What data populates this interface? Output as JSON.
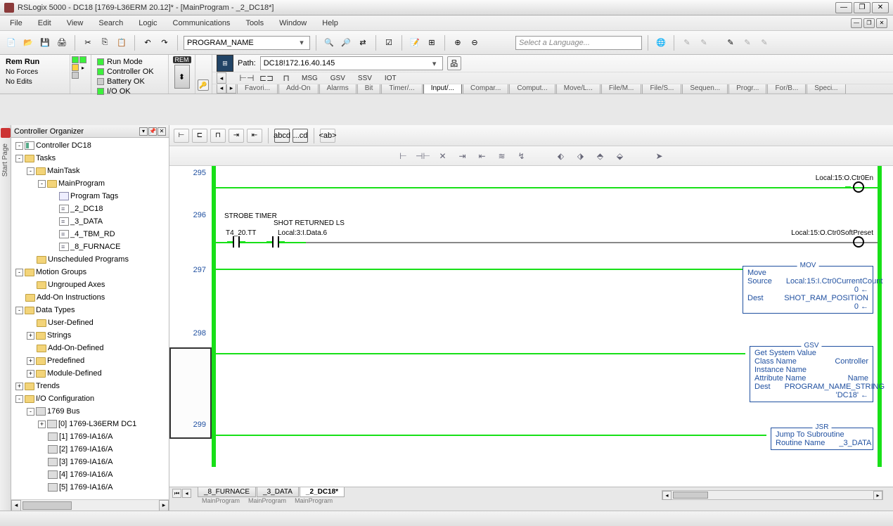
{
  "title": "RSLogix 5000 - DC18 [1769-L36ERM 20.12]* - [MainProgram - _2_DC18*]",
  "menu": [
    "File",
    "Edit",
    "View",
    "Search",
    "Logic",
    "Communications",
    "Tools",
    "Window",
    "Help"
  ],
  "toolbar_program": "PROGRAM_NAME",
  "language_placeholder": "Select a Language...",
  "status": {
    "mode_label": "Rem Run",
    "forces": "No Forces",
    "edits": "No Edits",
    "run_mode": "Run Mode",
    "controller_ok": "Controller OK",
    "battery_ok": "Battery OK",
    "io_ok": "I/O OK",
    "rem": "REM"
  },
  "path": {
    "label": "Path:",
    "value": "DC18!172.16.40.145"
  },
  "inst_text": [
    "MSG",
    "GSV",
    "SSV",
    "IOT"
  ],
  "sub_tabs": [
    "Favori...",
    "Add-On",
    "Alarms",
    "Bit",
    "Timer/...",
    "Input/...",
    "Compar...",
    "Comput...",
    "Move/L...",
    "File/M...",
    "File/S...",
    "Sequen...",
    "Progr...",
    "For/B...",
    "Speci..."
  ],
  "active_sub_tab": 5,
  "org_title": "Controller Organizer",
  "tree": [
    {
      "d": 0,
      "exp": "-",
      "ico": "ctrl",
      "label": "Controller DC18"
    },
    {
      "d": 0,
      "exp": "-",
      "ico": "folder",
      "label": "Tasks"
    },
    {
      "d": 1,
      "exp": "-",
      "ico": "folder",
      "label": "MainTask"
    },
    {
      "d": 2,
      "exp": "-",
      "ico": "folder",
      "label": "MainProgram"
    },
    {
      "d": 3,
      "exp": "",
      "ico": "tag",
      "label": "Program Tags"
    },
    {
      "d": 3,
      "exp": "",
      "ico": "ladder",
      "label": "_2_DC18"
    },
    {
      "d": 3,
      "exp": "",
      "ico": "ladder",
      "label": "_3_DATA"
    },
    {
      "d": 3,
      "exp": "",
      "ico": "ladder",
      "label": "_4_TBM_RD"
    },
    {
      "d": 3,
      "exp": "",
      "ico": "ladder",
      "label": "_8_FURNACE"
    },
    {
      "d": 1,
      "exp": "",
      "ico": "folder",
      "label": "Unscheduled Programs"
    },
    {
      "d": 0,
      "exp": "-",
      "ico": "folder",
      "label": "Motion Groups"
    },
    {
      "d": 1,
      "exp": "",
      "ico": "folder",
      "label": "Ungrouped Axes"
    },
    {
      "d": 0,
      "exp": "",
      "ico": "folder",
      "label": "Add-On Instructions"
    },
    {
      "d": 0,
      "exp": "-",
      "ico": "folder",
      "label": "Data Types"
    },
    {
      "d": 1,
      "exp": "",
      "ico": "folder",
      "label": "User-Defined"
    },
    {
      "d": 1,
      "exp": "+",
      "ico": "folder",
      "label": "Strings"
    },
    {
      "d": 1,
      "exp": "",
      "ico": "folder",
      "label": "Add-On-Defined"
    },
    {
      "d": 1,
      "exp": "+",
      "ico": "folder",
      "label": "Predefined"
    },
    {
      "d": 1,
      "exp": "+",
      "ico": "folder",
      "label": "Module-Defined"
    },
    {
      "d": 0,
      "exp": "+",
      "ico": "folder",
      "label": "Trends"
    },
    {
      "d": 0,
      "exp": "-",
      "ico": "folder",
      "label": "I/O Configuration"
    },
    {
      "d": 1,
      "exp": "-",
      "ico": "module",
      "label": "1769 Bus"
    },
    {
      "d": 2,
      "exp": "+",
      "ico": "module",
      "label": "[0] 1769-L36ERM DC1"
    },
    {
      "d": 2,
      "exp": "",
      "ico": "module",
      "label": "[1] 1769-IA16/A"
    },
    {
      "d": 2,
      "exp": "",
      "ico": "module",
      "label": "[2] 1769-IA16/A"
    },
    {
      "d": 2,
      "exp": "",
      "ico": "module",
      "label": "[3] 1769-IA16/A"
    },
    {
      "d": 2,
      "exp": "",
      "ico": "module",
      "label": "[4] 1769-IA16/A"
    },
    {
      "d": 2,
      "exp": "",
      "ico": "module",
      "label": "[5] 1769-IA16/A"
    }
  ],
  "rungs": {
    "r295": {
      "num": "295",
      "coil": "Local:15:O.Ctr0En"
    },
    "r296": {
      "num": "296",
      "c1_desc": "STROBE TIMER",
      "c1_tag": "T4_20.TT",
      "c2_desc": "SHOT RETURNED LS",
      "c2_tag": "Local:3:I.Data.6",
      "coil": "Local:15:O.Ctr0SoftPreset"
    },
    "r297": {
      "num": "297",
      "mov": {
        "title": "MOV",
        "l1": "Move",
        "src_l": "Source",
        "src_v": "Local:15:I.Ctr0CurrentCount",
        "src_n": "0",
        "dst_l": "Dest",
        "dst_v": "SHOT_RAM_POSITION",
        "dst_n": "0"
      }
    },
    "r298": {
      "num": "298",
      "gsv": {
        "title": "GSV",
        "l1": "Get System Value",
        "cn_l": "Class Name",
        "cn_v": "Controller",
        "in_l": "Instance Name",
        "an_l": "Attribute Name",
        "an_v": "Name",
        "d_l": "Dest",
        "d_v": "PROGRAM_NAME_STRING",
        "d_n": "'DC18'"
      }
    },
    "r299": {
      "num": "299",
      "jsr": {
        "title": "JSR",
        "l1": "Jump To Subroutine",
        "rn_l": "Routine Name",
        "rn_v": "_3_DATA"
      }
    }
  },
  "bottom_tabs": [
    "_8_FURNACE",
    "_3_DATA",
    "_2_DC18*"
  ],
  "bottom_sub": [
    "MainProgram",
    "MainProgram",
    "MainProgram"
  ],
  "active_bottom": 2,
  "ed_btns": [
    "abcd",
    "...cd",
    "<ab>"
  ]
}
